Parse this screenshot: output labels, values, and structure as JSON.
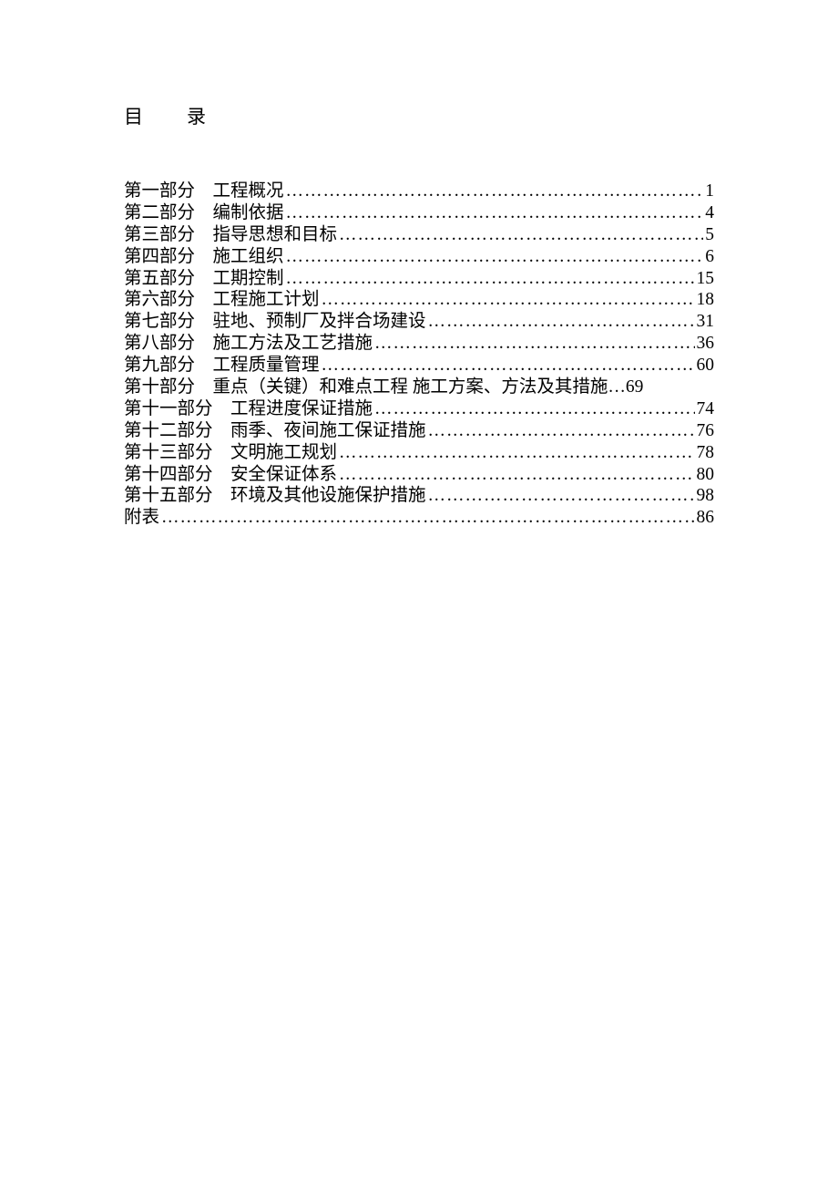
{
  "heading": "目录",
  "toc": [
    {
      "section": "第一部分",
      "gap": "　",
      "title": "工程概况",
      "page": "1"
    },
    {
      "section": "第二部分",
      "gap": "　",
      "title": "编制依据",
      "page": "4"
    },
    {
      "section": "第三部分",
      "gap": "　",
      "title": "指导思想和目标",
      "page": "5"
    },
    {
      "section": "第四部分",
      "gap": "　",
      "title": "施工组织",
      "page": "6"
    },
    {
      "section": "第五部分",
      "gap": "　",
      "title": "工期控制",
      "page": "15"
    },
    {
      "section": "第六部分",
      "gap": "　",
      "title": "工程施工计划",
      "page": "18"
    },
    {
      "section": "第七部分",
      "gap": "　",
      "title": "驻地、预制厂及拌合场建设",
      "page": "31"
    },
    {
      "section": "第八部分",
      "gap": "　",
      "title": "施工方法及工艺措施",
      "page": "36"
    },
    {
      "section": "第九部分",
      "gap": "　",
      "title": "工程质量管理",
      "page": "60"
    },
    {
      "section": "第十部分",
      "gap": "　",
      "title": "重点（关键）和难点工程 施工方案、方法及其措施 ",
      "page": "69",
      "shortLeader": true
    },
    {
      "section": "第十一部分",
      "gap": "　",
      "title": "工程进度保证措施",
      "page": "74"
    },
    {
      "section": "第十二部分",
      "gap": "　",
      "title": "雨季、夜间施工保证措施",
      "page": "76"
    },
    {
      "section": "第十三部分",
      "gap": "　",
      "title": "文明施工规划",
      "page": "78"
    },
    {
      "section": "第十四部分",
      "gap": "　",
      "title": "安全保证体系",
      "page": "80"
    },
    {
      "section": "第十五部分",
      "gap": "　",
      "title": "环境及其他设施保护措施",
      "page": "98"
    },
    {
      "section": "附表",
      "gap": "",
      "title": "",
      "page": "86"
    }
  ]
}
